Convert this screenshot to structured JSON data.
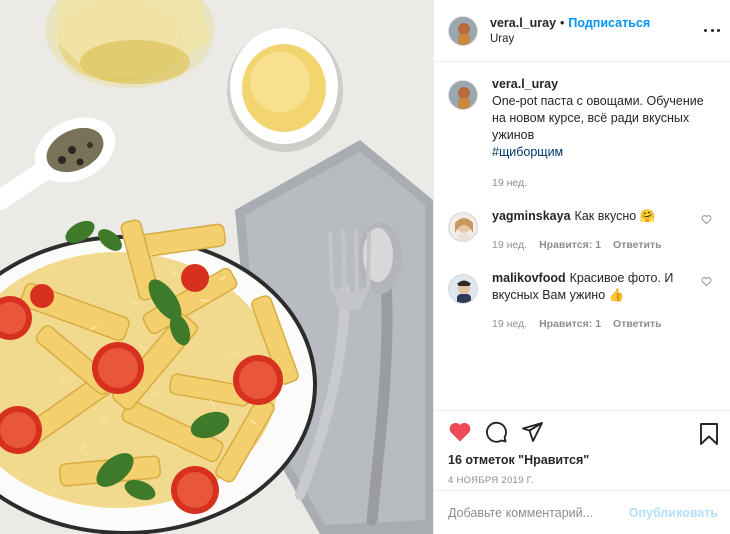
{
  "post": {
    "author": "vera.l_uray",
    "follow_label": "Подписаться",
    "separator": "•",
    "location": "Uray",
    "more_icon": "more-horizontal-icon"
  },
  "caption": {
    "username": "vera.l_uray",
    "text": "One-pot паста с овощами. Обучение на новом курсе, всё ради вкусных ужинов",
    "hashtag": "#щиборщим",
    "time": "19 нед."
  },
  "comments": [
    {
      "username": "yagminskaya",
      "text": "Как вкусно 🤗",
      "time": "19 нед.",
      "likes": "Нравится: 1",
      "reply": "Ответить"
    },
    {
      "username": "malikovfood",
      "text": "Красивое фото. И вкусных Вам ужино 👍",
      "time": "19 нед.",
      "likes": "Нравится: 1",
      "reply": "Ответить"
    }
  ],
  "actions": {
    "like_icon": "heart-filled-icon",
    "comment_icon": "comment-icon",
    "share_icon": "share-icon",
    "save_icon": "bookmark-icon",
    "like_color": "#ed4956",
    "likes_text": "16 отметок \"Нравится\"",
    "date": "4 НОЯБРЯ 2019 Г."
  },
  "add_comment": {
    "placeholder": "Добавьте комментарий...",
    "publish_label": "Опубликовать"
  },
  "colors": {
    "link_blue": "#0095f6",
    "publish_disabled": "#b2dffc",
    "muted": "#8e8e8e"
  }
}
